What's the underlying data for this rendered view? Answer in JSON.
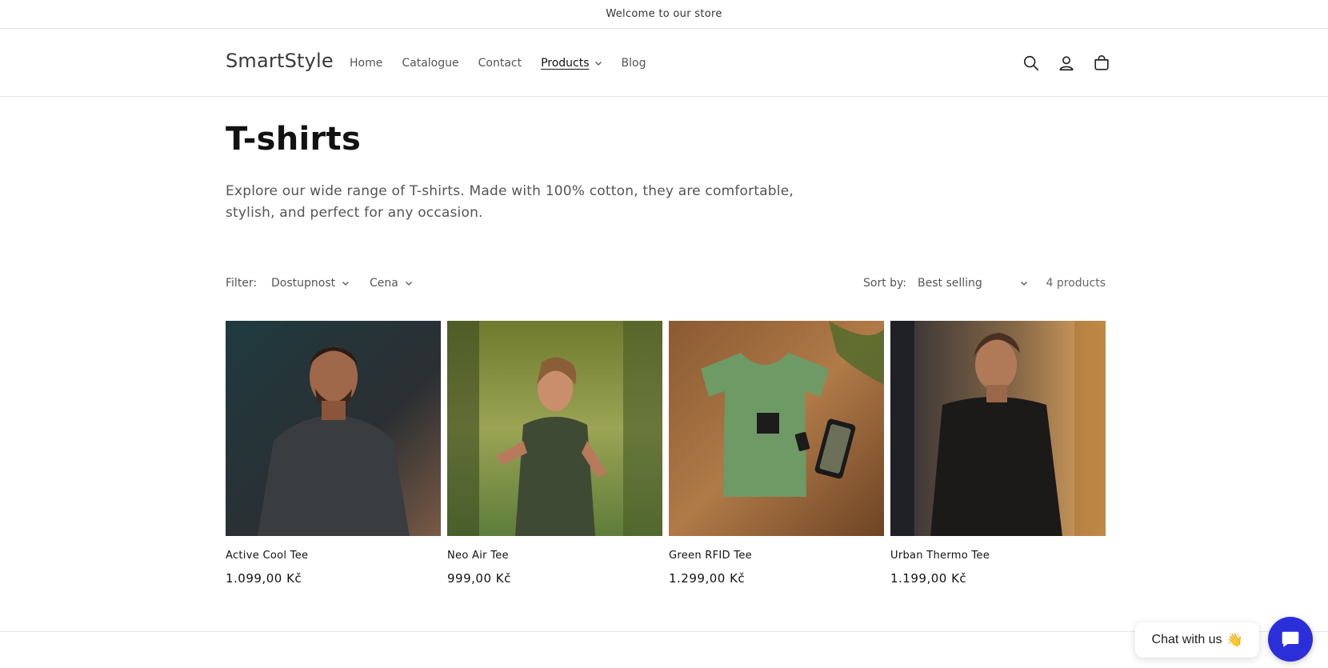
{
  "announcement": {
    "text": "Welcome to our store"
  },
  "header": {
    "logo": "SmartStyle",
    "nav": [
      {
        "label": "Home"
      },
      {
        "label": "Catalogue"
      },
      {
        "label": "Contact"
      },
      {
        "label": "Products",
        "active": true,
        "has_dropdown": true
      },
      {
        "label": "Blog"
      }
    ],
    "icons": [
      "search-icon",
      "account-icon",
      "cart-icon"
    ]
  },
  "collection": {
    "title": "T-shirts",
    "description": "Explore our wide range of T-shirts. Made with 100% cotton, they are comfortable, stylish, and perfect for any occasion."
  },
  "toolbar": {
    "filter_label": "Filter:",
    "filters": [
      {
        "label": "Dostupnost"
      },
      {
        "label": "Cena"
      }
    ],
    "sort_label": "Sort by:",
    "sort_value": "Best selling",
    "product_count": "4 products"
  },
  "products": [
    {
      "name": "Active Cool Tee",
      "price": "1.099,00 Kč"
    },
    {
      "name": "Neo Air Tee",
      "price": "999,00 Kč"
    },
    {
      "name": "Green RFID Tee",
      "price": "1.299,00 Kč"
    },
    {
      "name": "Urban Thermo Tee",
      "price": "1.199,00 Kč"
    }
  ],
  "chat": {
    "label": "Chat with us",
    "emoji": "👋"
  },
  "colors": {
    "chat_accent": "#2b2fd9",
    "border": "#e6e6e6",
    "text": "#121212"
  }
}
